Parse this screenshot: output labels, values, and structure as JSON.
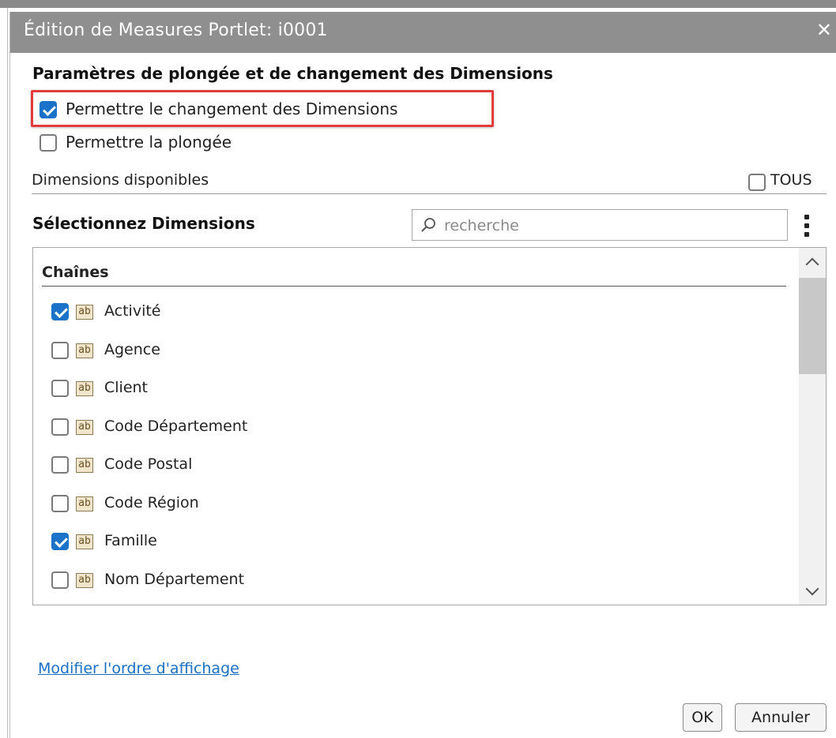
{
  "dialog": {
    "title": "Édition de Measures Portlet: i0001",
    "close_label": "✕"
  },
  "drill": {
    "section_title": "Paramètres de plongée et de changement des Dimensions",
    "allow_dimension_change": {
      "label": "Permettre le changement des Dimensions",
      "checked": true
    },
    "allow_drill": {
      "label": "Permettre la plongée",
      "checked": false
    }
  },
  "available": {
    "label": "Dimensions disponibles",
    "all": {
      "label": "TOUS",
      "checked": false
    }
  },
  "selector": {
    "title": "Sélectionnez Dimensions",
    "search_placeholder": "recherche",
    "group_header": "Chaînes",
    "type_icon": "ab",
    "items": [
      {
        "label": "Activité",
        "checked": true
      },
      {
        "label": "Agence",
        "checked": false
      },
      {
        "label": "Client",
        "checked": false
      },
      {
        "label": "Code Département",
        "checked": false
      },
      {
        "label": "Code Postal",
        "checked": false
      },
      {
        "label": "Code Région",
        "checked": false
      },
      {
        "label": "Famille",
        "checked": true
      },
      {
        "label": "Nom Département",
        "checked": false
      }
    ]
  },
  "footer": {
    "order_link": "Modifier l'ordre d'affichage",
    "ok_label": "OK",
    "cancel_label": "Annuler"
  },
  "colors": {
    "titlebar": "#8f8f8f",
    "highlight": "#e23b3b",
    "checkbox_checked": "#1a73c8",
    "link": "#1a6fc4"
  }
}
